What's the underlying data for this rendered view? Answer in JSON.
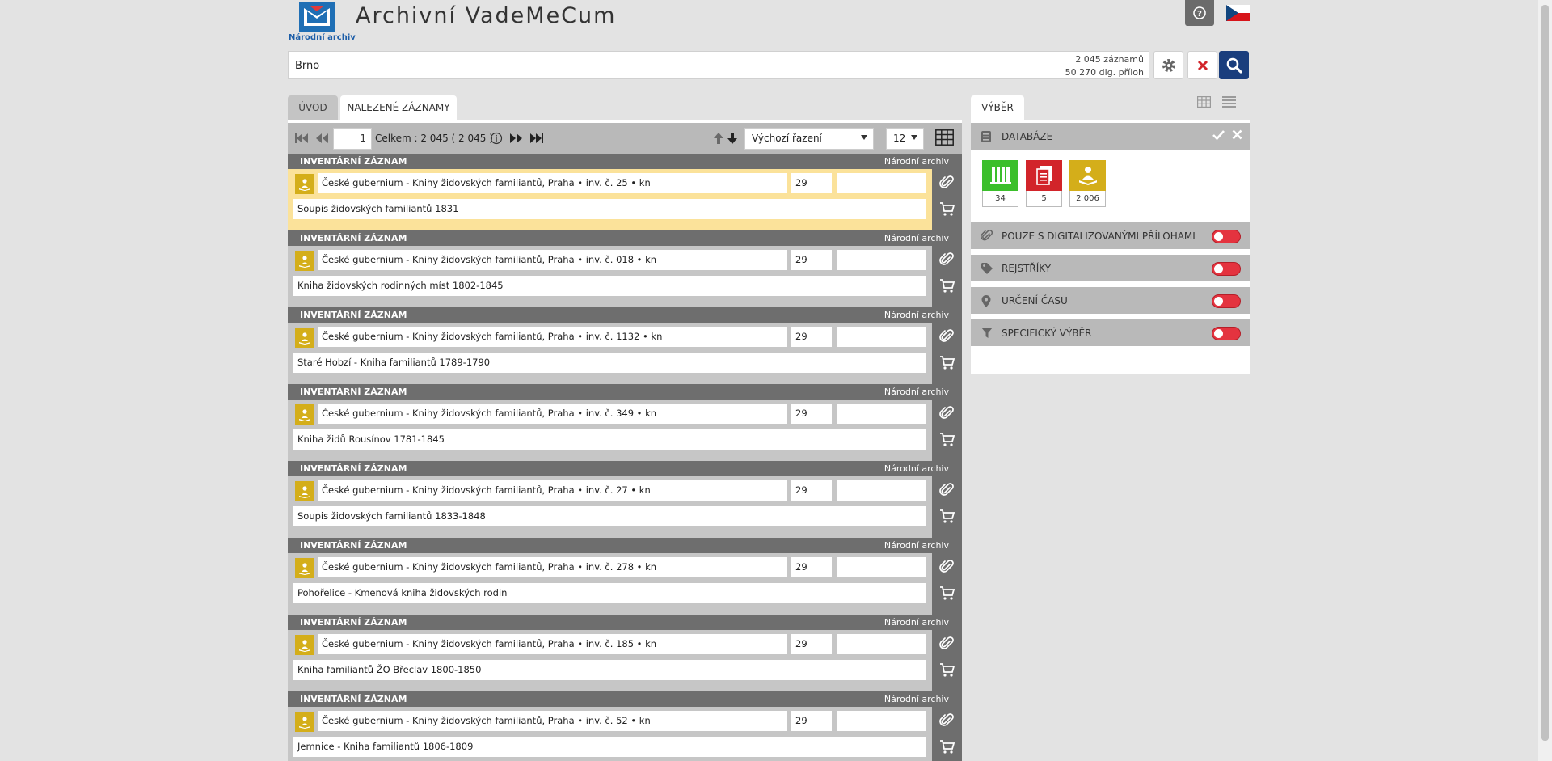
{
  "header": {
    "logo_text": "Národní archiv",
    "app_title": "Archivní VadeMeCum"
  },
  "search": {
    "value": "Brno",
    "records_count": "2 045 záznamů",
    "digital_count": "50 270 dig. příloh"
  },
  "tabs": {
    "uvod": "ÚVOD",
    "nalezene": "NALEZENÉ ZÁZNAMY",
    "vyber": "VÝBĚR"
  },
  "toolbar": {
    "page": "1",
    "total": "Celkem : 2 045  ( 2 045 )",
    "sort": "Výchozí řazení",
    "per_page": "12"
  },
  "records": [
    {
      "type": "INVENTÁRNÍ ZÁZNAM",
      "archive": "Národní archiv",
      "path": "České gubernium - Knihy židovských familiantů, Praha • inv. č. 25 • kn",
      "num": "29",
      "title": "Soupis židovských familiantů 1831"
    },
    {
      "type": "INVENTÁRNÍ ZÁZNAM",
      "archive": "Národní archiv",
      "path": "České gubernium - Knihy židovských familiantů, Praha • inv. č. 018 • kn",
      "num": "29",
      "title": "Kniha židovských rodinných míst 1802-1845"
    },
    {
      "type": "INVENTÁRNÍ ZÁZNAM",
      "archive": "Národní archiv",
      "path": "České gubernium - Knihy židovských familiantů, Praha • inv. č. 1132 • kn",
      "num": "29",
      "title": "Staré Hobzí - Kniha familiantů 1789-1790"
    },
    {
      "type": "INVENTÁRNÍ ZÁZNAM",
      "archive": "Národní archiv",
      "path": "České gubernium - Knihy židovských familiantů, Praha • inv. č. 349 • kn",
      "num": "29",
      "title": "Kniha židů Rousínov 1781-1845"
    },
    {
      "type": "INVENTÁRNÍ ZÁZNAM",
      "archive": "Národní archiv",
      "path": "České gubernium - Knihy židovských familiantů, Praha • inv. č. 27 • kn",
      "num": "29",
      "title": "Soupis židovských familiantů 1833-1848"
    },
    {
      "type": "INVENTÁRNÍ ZÁZNAM",
      "archive": "Národní archiv",
      "path": "České gubernium - Knihy židovských familiantů, Praha • inv. č. 278 • kn",
      "num": "29",
      "title": "Pohořelice - Kmenová kniha židovských rodin"
    },
    {
      "type": "INVENTÁRNÍ ZÁZNAM",
      "archive": "Národní archiv",
      "path": "České gubernium - Knihy židovských familiantů, Praha • inv. č. 185 • kn",
      "num": "29",
      "title": "Kniha familiantů ŽO Břeclav 1800-1850"
    },
    {
      "type": "INVENTÁRNÍ ZÁZNAM",
      "archive": "Národní archiv",
      "path": "České gubernium - Knihy židovských familiantů, Praha • inv. č. 52 • kn",
      "num": "29",
      "title": "Jemnice - Kniha familiantů 1806-1809"
    }
  ],
  "panel": {
    "databaze": "DATABÁZE",
    "db_counts": [
      "34",
      "5",
      "2 006"
    ],
    "db_colors": [
      "#3bbf2b",
      "#d2242a",
      "#d4ae1a"
    ],
    "filters": [
      {
        "label": "POUZE S DIGITALIZOVANÝMI PŘÍLOHAMI",
        "icon": "paperclip-icon"
      },
      {
        "label": "REJSTŘÍKY",
        "icon": "tag-icon"
      },
      {
        "label": "URČENÍ ČASU",
        "icon": "map-pin-icon"
      },
      {
        "label": "SPECIFICKÝ VÝBĚR",
        "icon": "filter-icon"
      }
    ]
  }
}
